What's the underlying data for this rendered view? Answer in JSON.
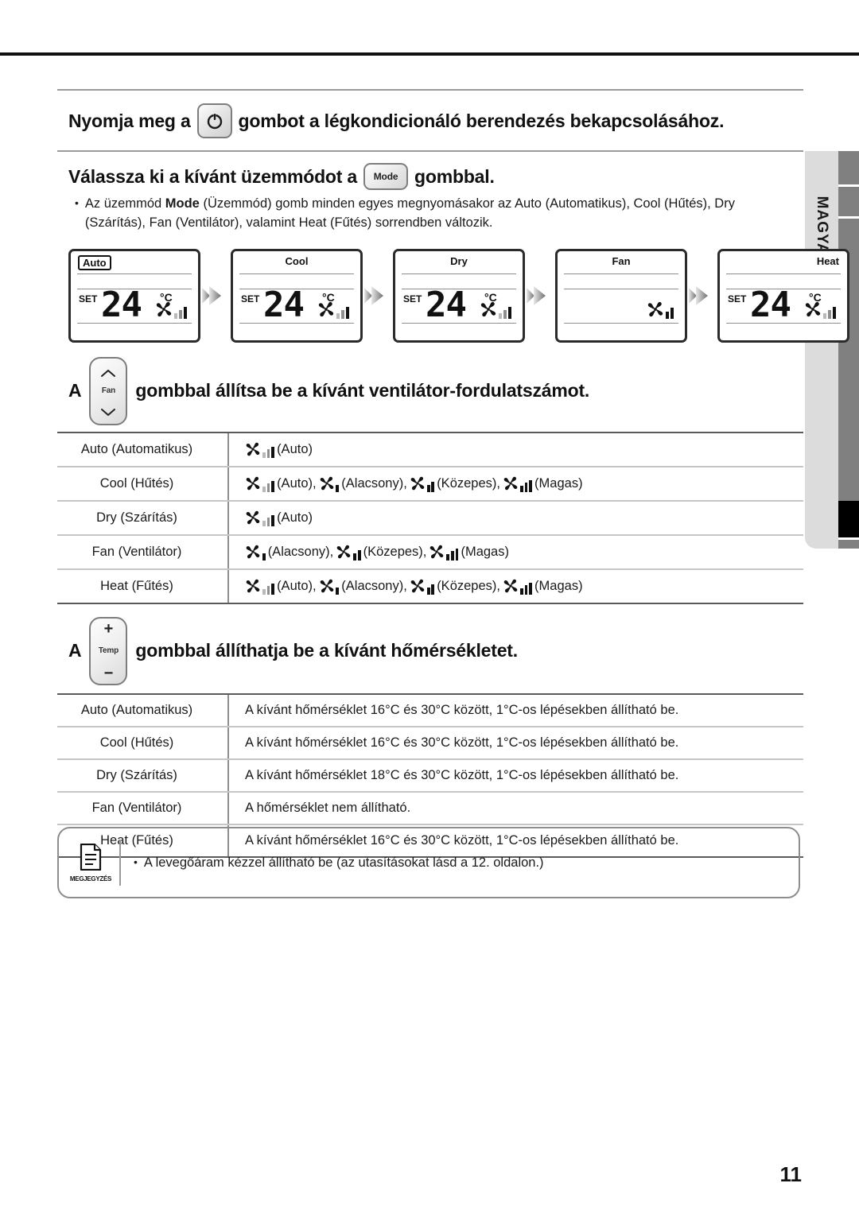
{
  "document": {
    "language_tab": "MAGYAR",
    "page_number": "11"
  },
  "section_power": {
    "heading_before": "Nyomja meg a",
    "button_icon": "power-icon",
    "heading_after": "gombot a légkondicionáló berendezés bekapcsolásához."
  },
  "section_mode": {
    "heading_before": "Válassza ki a kívánt üzemmódot a",
    "button_label": "Mode",
    "heading_after": "gombbal.",
    "bullet": {
      "part1": "Az üzemmód ",
      "bold": "Mode",
      "part2": " (Üzemmód) gomb minden egyes megnyomásakor az Auto (Automatikus), Cool (Hűtés), Dry (Szárítás), Fan (Ventilátor), valamint Heat (Fűtés) sorrendben változik."
    },
    "displays": [
      {
        "mode": "Auto",
        "mode_align": "left",
        "boxed": true,
        "set": "SET",
        "temp": "24",
        "unit": "°C",
        "fan": "auto",
        "show_temp": true
      },
      {
        "mode": "Cool",
        "mode_align": "center",
        "boxed": false,
        "set": "SET",
        "temp": "24",
        "unit": "°C",
        "fan": "auto",
        "show_temp": true
      },
      {
        "mode": "Dry",
        "mode_align": "center",
        "boxed": false,
        "set": "SET",
        "temp": "24",
        "unit": "°C",
        "fan": "auto",
        "show_temp": true
      },
      {
        "mode": "Fan",
        "mode_align": "center",
        "boxed": false,
        "set": "",
        "temp": "",
        "unit": "",
        "fan": "medium",
        "show_temp": false
      },
      {
        "mode": "Heat",
        "mode_align": "right",
        "boxed": false,
        "set": "SET",
        "temp": "24",
        "unit": "°C",
        "fan": "auto",
        "show_temp": true
      }
    ]
  },
  "section_fan": {
    "heading_before": "A",
    "button_label": "Fan",
    "button_up_icon": "chevron-up-icon",
    "button_down_icon": "chevron-down-icon",
    "heading_after": "gombbal állítsa be a kívánt ventilátor-fordulatszámot.",
    "rows": [
      {
        "mode": "Auto (Automatikus)",
        "options": [
          {
            "level": "auto",
            "label": "(Auto)"
          }
        ]
      },
      {
        "mode": "Cool (Hűtés)",
        "options": [
          {
            "level": "auto",
            "label": "(Auto),"
          },
          {
            "level": "low",
            "label": "(Alacsony),"
          },
          {
            "level": "medium",
            "label": "(Közepes),"
          },
          {
            "level": "high",
            "label": "(Magas)"
          }
        ]
      },
      {
        "mode": "Dry (Szárítás)",
        "options": [
          {
            "level": "auto",
            "label": "(Auto)"
          }
        ]
      },
      {
        "mode": "Fan (Ventilátor)",
        "options": [
          {
            "level": "low",
            "label": "(Alacsony),"
          },
          {
            "level": "medium",
            "label": "(Közepes),"
          },
          {
            "level": "high",
            "label": "(Magas)"
          }
        ]
      },
      {
        "mode": "Heat (Fűtés)",
        "options": [
          {
            "level": "auto",
            "label": "(Auto),"
          },
          {
            "level": "low",
            "label": "(Alacsony),"
          },
          {
            "level": "medium",
            "label": "(Közepes),"
          },
          {
            "level": "high",
            "label": "(Magas)"
          }
        ]
      }
    ]
  },
  "section_temp": {
    "heading_before": "A",
    "button_label": "Temp",
    "button_plus": "+",
    "button_minus": "−",
    "heading_after": "gombbal állíthatja be a kívánt hőmérsékletet.",
    "rows": [
      {
        "mode": "Auto (Automatikus)",
        "desc": "A kívánt hőmérséklet 16°C és 30°C között, 1°C-os lépésekben állítható be."
      },
      {
        "mode": "Cool (Hűtés)",
        "desc": "A kívánt hőmérséklet 16°C és 30°C között, 1°C-os lépésekben állítható be."
      },
      {
        "mode": "Dry (Szárítás)",
        "desc": "A kívánt hőmérséklet 18°C és 30°C között, 1°C-os lépésekben állítható be."
      },
      {
        "mode": "Fan (Ventilátor)",
        "desc": "A hőmérséklet nem állítható."
      },
      {
        "mode": "Heat (Fűtés)",
        "desc": "A kívánt hőmérséklet 16°C és 30°C között, 1°C-os lépésekben állítható be."
      }
    ]
  },
  "note": {
    "icon": "document-note-icon",
    "icon_caption": "MEGJEGYZÉS",
    "bullet": "•",
    "text": "A levegőáram kézzel állítható be (az utasításokat lásd a 12. oldalon.)"
  },
  "colors": {
    "rule": "#9a9a9a",
    "rule_dark": "#5a5a5a",
    "tab_bg": "#dcdcdc",
    "rail": "#808080",
    "text": "#1a1a1a"
  }
}
